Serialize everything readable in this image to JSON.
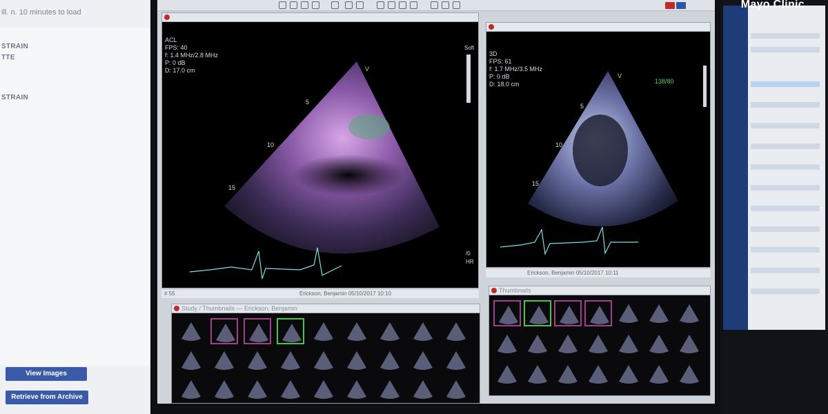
{
  "left_panel": {
    "note": "ill. n. 10 minutes to load",
    "items": [
      "STRAIN",
      "TTE",
      "",
      "STRAIN"
    ],
    "buttons": {
      "view_images": "View Images",
      "retrieve": "Retrieve from Archive"
    }
  },
  "viewer_left": {
    "info": [
      "ACL",
      "FPS: 40",
      "f: 1.4 MHz/2.8 MHz",
      "P: 0 dB",
      "D: 17.0 cm"
    ],
    "depth_marks": [
      "5",
      "10",
      "15"
    ],
    "marker": "V",
    "scale_label": "Soft",
    "side_labels": [
      "/0",
      "HR"
    ],
    "caption": "Erickson, Benjamin 05/10/2017 10:10",
    "frame": "# 55"
  },
  "viewer_right": {
    "info": [
      "3D",
      "FPS: 61",
      "f: 1.7 MHz/3.5 MHz",
      "P: 0 dB",
      "D: 18.0 cm"
    ],
    "depth_marks": [
      "5",
      "10",
      "15"
    ],
    "marker": "V",
    "hr_label": "138/80",
    "caption": "Erickson, Benjamin 05/10/2017 10:11"
  },
  "strips": {
    "left_title": "Study / Thumbnails — Erickson, Benjamin",
    "right_title": "Thumbnails"
  },
  "watermark": "Mayo Clinic",
  "colors": {
    "accent_magenta": "#a0408f",
    "selected_green": "#44c84a",
    "button_blue": "#3a5aa8"
  }
}
